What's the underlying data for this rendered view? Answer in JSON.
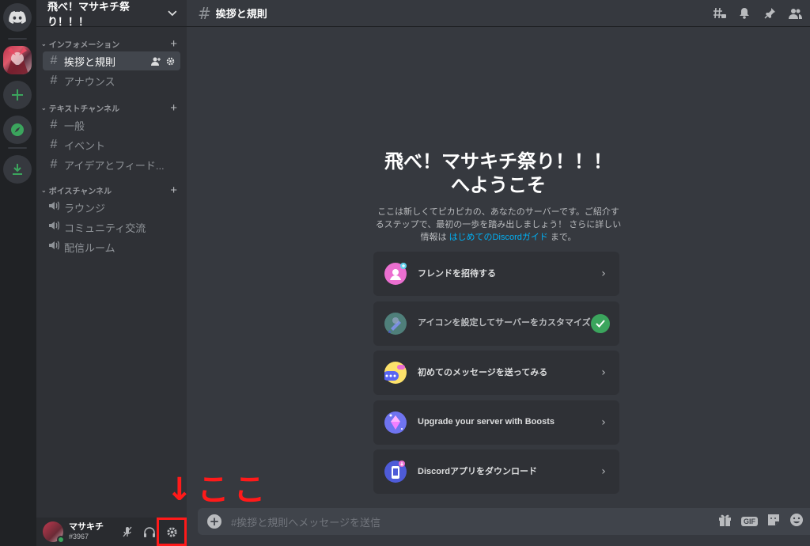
{
  "server": {
    "name": "飛べ！マサキチ祭り！！！"
  },
  "categories": [
    {
      "name": "インフォメーション",
      "channels": [
        {
          "label": "挨拶と規則",
          "type": "text",
          "active": true
        },
        {
          "label": "アナウンス",
          "type": "text"
        }
      ]
    },
    {
      "name": "テキストチャンネル",
      "channels": [
        {
          "label": "一般",
          "type": "text"
        },
        {
          "label": "イベント",
          "type": "text"
        },
        {
          "label": "アイデアとフィード...",
          "type": "text"
        }
      ]
    },
    {
      "name": "ボイスチャンネル",
      "channels": [
        {
          "label": "ラウンジ",
          "type": "voice"
        },
        {
          "label": "コミュニティ交流",
          "type": "voice"
        },
        {
          "label": "配信ルーム",
          "type": "voice"
        }
      ]
    }
  ],
  "user": {
    "name": "マサキチ",
    "tag": "#3967"
  },
  "annotation": "↓ここ",
  "topbar": {
    "channel": "挨拶と規則"
  },
  "welcome": {
    "title_line1": "飛べ！マサキチ祭り！！！",
    "title_line2": "へようこそ",
    "desc_line1": "ここは新しくてピカピカの、あなたのサーバーです。ご紹介す",
    "desc_line2": "るステップで、最初の一歩を踏み出しましょう！ さらに詳しい",
    "desc_prefix": "情報は ",
    "desc_link": "はじめてのDiscordガイド",
    "desc_suffix": " まで。"
  },
  "cards": [
    {
      "label": "フレンドを招待する",
      "icon": "invite-icon",
      "done": false
    },
    {
      "label": "アイコンを設定してサーバーをカスタマイズ",
      "icon": "paintbrush-icon",
      "done": true
    },
    {
      "label": "初めてのメッセージを送ってみる",
      "icon": "chat-bubble-icon",
      "done": false
    },
    {
      "label": "Upgrade your server with Boosts",
      "icon": "boost-gem-icon",
      "done": false
    },
    {
      "label": "Discordアプリをダウンロード",
      "icon": "phone-download-icon",
      "done": false
    }
  ],
  "composer": {
    "placeholder": "#挨拶と規則へメッセージを送信",
    "gif_label": "GIF"
  },
  "colors": {
    "accent_green": "#3ba55d",
    "link_blue": "#00b0f4",
    "highlight_red": "#ff1a1a"
  }
}
